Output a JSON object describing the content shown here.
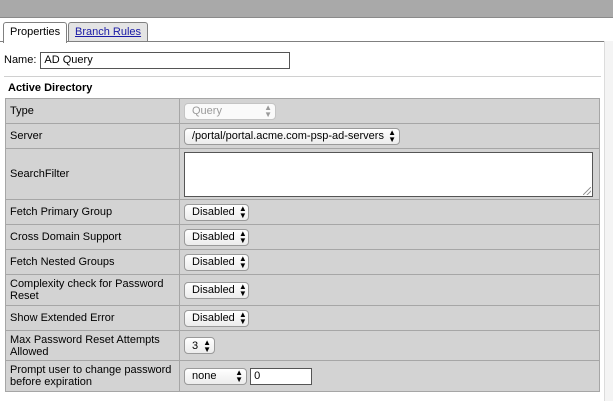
{
  "tabs": [
    {
      "label": "Properties"
    },
    {
      "label": "Branch Rules"
    }
  ],
  "name_field": {
    "label": "Name:",
    "value": "AD Query"
  },
  "section_title": "Active Directory",
  "rows": {
    "type": {
      "label": "Type",
      "value": "Query"
    },
    "server": {
      "label": "Server",
      "value": "/portal/portal.acme.com-psp-ad-servers"
    },
    "search_filter": {
      "label": "SearchFilter",
      "value": ""
    },
    "fetch_primary_group": {
      "label": "Fetch Primary Group",
      "value": "Disabled"
    },
    "cross_domain_support": {
      "label": "Cross Domain Support",
      "value": "Disabled"
    },
    "fetch_nested_groups": {
      "label": "Fetch Nested Groups",
      "value": "Disabled"
    },
    "complexity_check": {
      "label": "Complexity check for Password Reset",
      "value": "Disabled"
    },
    "show_extended_error": {
      "label": "Show Extended Error",
      "value": "Disabled"
    },
    "max_password_reset": {
      "label": "Max Password Reset Attempts Allowed",
      "value": "3"
    },
    "prompt_change_password": {
      "label": "Prompt user to change password before expiration",
      "select_value": "none",
      "input_value": "0"
    }
  }
}
